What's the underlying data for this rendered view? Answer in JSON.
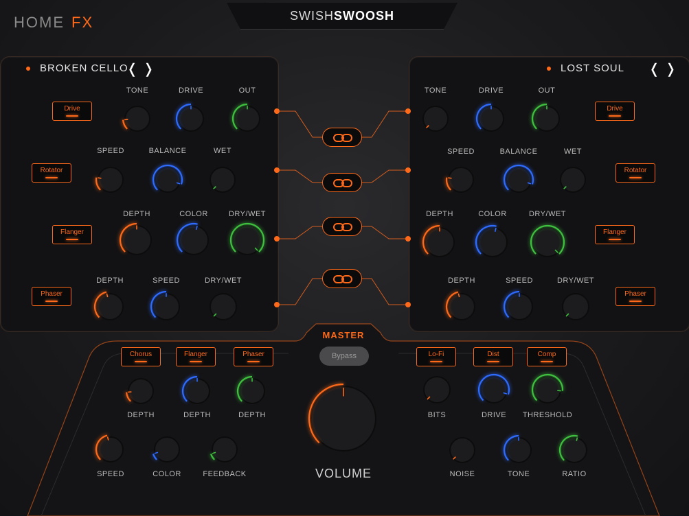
{
  "nav": {
    "home": "HOME",
    "fx": "FX"
  },
  "brand": {
    "light": "SWISH",
    "bold": "SWOOSH"
  },
  "left_chain": {
    "preset": "BROKEN CELLO",
    "modules": [
      {
        "name": "Drive",
        "params": [
          {
            "label": "TONE",
            "value": 0.15
          },
          {
            "label": "DRIVE",
            "value": 0.5
          },
          {
            "label": "OUT",
            "value": 0.5
          }
        ]
      },
      {
        "name": "Rotator",
        "params": [
          {
            "label": "SPEED",
            "value": 0.2
          },
          {
            "label": "BALANCE",
            "value": 0.9
          },
          {
            "label": "WET",
            "value": 0.0
          }
        ]
      },
      {
        "name": "Flanger",
        "params": [
          {
            "label": "DEPTH",
            "value": 0.5
          },
          {
            "label": "COLOR",
            "value": 0.55
          },
          {
            "label": "DRY/WET",
            "value": 1.0
          }
        ]
      },
      {
        "name": "Phaser",
        "params": [
          {
            "label": "DEPTH",
            "value": 0.45
          },
          {
            "label": "SPEED",
            "value": 0.5
          },
          {
            "label": "DRY/WET",
            "value": 0.0
          }
        ]
      }
    ]
  },
  "right_chain": {
    "preset": "LOST SOUL",
    "modules": [
      {
        "name": "Drive",
        "params": [
          {
            "label": "TONE",
            "value": 0.0
          },
          {
            "label": "DRIVE",
            "value": 0.5
          },
          {
            "label": "OUT",
            "value": 0.5
          }
        ]
      },
      {
        "name": "Rotator",
        "params": [
          {
            "label": "SPEED",
            "value": 0.2
          },
          {
            "label": "BALANCE",
            "value": 0.9
          },
          {
            "label": "WET",
            "value": 0.0
          }
        ]
      },
      {
        "name": "Flanger",
        "params": [
          {
            "label": "DEPTH",
            "value": 0.5
          },
          {
            "label": "COLOR",
            "value": 0.55
          },
          {
            "label": "DRY/WET",
            "value": 1.0
          }
        ]
      },
      {
        "name": "Phaser",
        "params": [
          {
            "label": "DEPTH",
            "value": 0.45
          },
          {
            "label": "SPEED",
            "value": 0.5
          },
          {
            "label": "DRY/WET",
            "value": 0.0
          }
        ]
      }
    ]
  },
  "master": {
    "title": "MASTER",
    "bypass": "Bypass",
    "volume_label": "VOLUME",
    "volume_value": 0.5,
    "left_buttons": [
      "Chorus",
      "Flanger",
      "Phaser"
    ],
    "right_buttons": [
      "Lo-Fi",
      "Dist",
      "Comp"
    ],
    "left_knobs_row1": [
      {
        "label": "DEPTH",
        "value": 0.15
      },
      {
        "label": "DEPTH",
        "value": 0.5
      },
      {
        "label": "DEPTH",
        "value": 0.5
      }
    ],
    "left_knobs_row2": [
      {
        "label": "SPEED",
        "value": 0.45
      },
      {
        "label": "COLOR",
        "value": 0.1
      },
      {
        "label": "FEEDBACK",
        "value": 0.1
      }
    ],
    "right_knobs_row1": [
      {
        "label": "BITS",
        "value": 0.0
      },
      {
        "label": "DRIVE",
        "value": 0.9
      },
      {
        "label": "THRESHOLD",
        "value": 0.85
      }
    ],
    "right_knobs_row2": [
      {
        "label": "NOISE",
        "value": 0.0
      },
      {
        "label": "TONE",
        "value": 0.5
      },
      {
        "label": "RATIO",
        "value": 0.55
      }
    ]
  },
  "colors": {
    "accent": "#ff6a1a",
    "blue": "#2e6bff",
    "green": "#3fc13f",
    "panel": "#121214",
    "bg": "#1b1b1d"
  }
}
